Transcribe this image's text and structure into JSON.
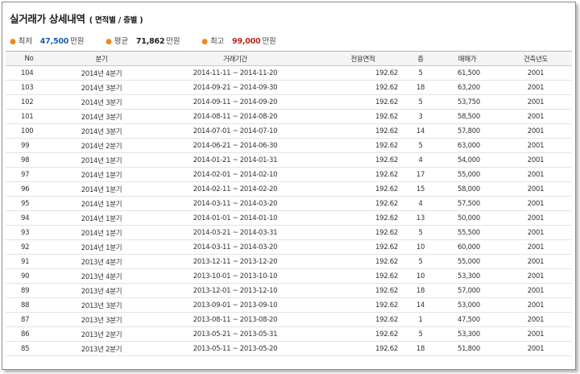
{
  "title": "실거래가 상세내역",
  "subtitle": "( 면적별 / 층별 )",
  "stats": [
    {
      "label": "최저",
      "value": "47,500",
      "unit": "만원",
      "color": "#1f5fae"
    },
    {
      "label": "평균",
      "value": "71,862",
      "unit": "만원",
      "color": "#222222"
    },
    {
      "label": "최고",
      "value": "99,000",
      "unit": "만원",
      "color": "#b22b1f"
    }
  ],
  "columns": [
    "No",
    "분기",
    "거래기간",
    "전용면적",
    "층",
    "매매가",
    "건축년도"
  ],
  "rows": [
    [
      "104",
      "2014년 4분기",
      "2014-11-11 ~ 2014-11-20",
      "192.62",
      "5",
      "61,500",
      "2001"
    ],
    [
      "103",
      "2014년 3분기",
      "2014-09-21 ~ 2014-09-30",
      "192.62",
      "18",
      "63,200",
      "2001"
    ],
    [
      "102",
      "2014년 3분기",
      "2014-09-11 ~ 2014-09-20",
      "192.62",
      "5",
      "53,750",
      "2001"
    ],
    [
      "101",
      "2014년 3분기",
      "2014-08-11 ~ 2014-08-20",
      "192.62",
      "3",
      "58,500",
      "2001"
    ],
    [
      "100",
      "2014년 3분기",
      "2014-07-01 ~ 2014-07-10",
      "192.62",
      "14",
      "57,800",
      "2001"
    ],
    [
      "99",
      "2014년 2분기",
      "2014-06-21 ~ 2014-06-30",
      "192.62",
      "5",
      "63,000",
      "2001"
    ],
    [
      "98",
      "2014년 1분기",
      "2014-01-21 ~ 2014-01-31",
      "192.62",
      "4",
      "54,000",
      "2001"
    ],
    [
      "97",
      "2014년 1분기",
      "2014-02-01 ~ 2014-02-10",
      "192.62",
      "17",
      "55,000",
      "2001"
    ],
    [
      "96",
      "2014년 1분기",
      "2014-02-11 ~ 2014-02-20",
      "192.62",
      "15",
      "58,000",
      "2001"
    ],
    [
      "95",
      "2014년 1분기",
      "2014-03-11 ~ 2014-03-20",
      "192.62",
      "4",
      "57,500",
      "2001"
    ],
    [
      "94",
      "2014년 1분기",
      "2014-01-01 ~ 2014-01-10",
      "192.62",
      "13",
      "50,000",
      "2001"
    ],
    [
      "93",
      "2014년 1분기",
      "2014-03-21 ~ 2014-03-31",
      "192.62",
      "5",
      "55,500",
      "2001"
    ],
    [
      "92",
      "2014년 1분기",
      "2014-03-11 ~ 2014-03-20",
      "192.62",
      "10",
      "60,000",
      "2001"
    ],
    [
      "91",
      "2013년 4분기",
      "2013-12-11 ~ 2013-12-20",
      "192.62",
      "5",
      "55,000",
      "2001"
    ],
    [
      "90",
      "2013년 4분기",
      "2013-10-01 ~ 2013-10-10",
      "192.62",
      "10",
      "53,300",
      "2001"
    ],
    [
      "89",
      "2013년 4분기",
      "2013-12-01 ~ 2013-12-10",
      "192.62",
      "18",
      "57,000",
      "2001"
    ],
    [
      "88",
      "2013년 3분기",
      "2013-09-01 ~ 2013-09-10",
      "192.62",
      "14",
      "53,000",
      "2001"
    ],
    [
      "87",
      "2013년 3분기",
      "2013-08-11 ~ 2013-08-20",
      "192.62",
      "1",
      "47,500",
      "2001"
    ],
    [
      "86",
      "2013년 2분기",
      "2013-05-21 ~ 2013-05-31",
      "192.62",
      "5",
      "53,300",
      "2001"
    ],
    [
      "85",
      "2013년 2분기",
      "2013-05-11 ~ 2013-05-20",
      "192.62",
      "18",
      "51,800",
      "2001"
    ]
  ]
}
